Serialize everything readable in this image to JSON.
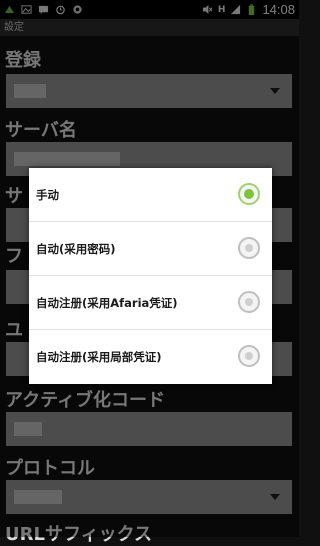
{
  "status_bar": {
    "time": "14:08",
    "network_label": "H",
    "icons": [
      "android-nav-icon",
      "image-icon",
      "sms-icon",
      "alarm-icon",
      "app-icon",
      "mute-icon",
      "signal-icon",
      "battery-icon"
    ]
  },
  "title_bar": {
    "title": "設定"
  },
  "form": {
    "fields": [
      {
        "label": "登録",
        "type": "select"
      },
      {
        "label": "サーバ名",
        "type": "text"
      },
      {
        "label": "サ",
        "type": "hidden-behind-dialog"
      },
      {
        "label": "フ",
        "type": "hidden-behind-dialog"
      },
      {
        "label": "ユ",
        "type": "hidden-behind-dialog"
      },
      {
        "label": "アクティブ化コード",
        "type": "text"
      },
      {
        "label": "プロトコル",
        "type": "select"
      },
      {
        "label": "URLサフィックス",
        "type": "text"
      }
    ]
  },
  "dialog": {
    "options": [
      {
        "label": "手动",
        "selected": true
      },
      {
        "label": "自动(采用密码)",
        "selected": false
      },
      {
        "label": "自动注册(采用Afaria凭证)",
        "selected": false
      },
      {
        "label": "自动注册(采用局部凭证)",
        "selected": false
      }
    ]
  },
  "colors": {
    "radio_selected": "#7ec33c",
    "background": "#101010",
    "field": "#8a8a8a"
  }
}
